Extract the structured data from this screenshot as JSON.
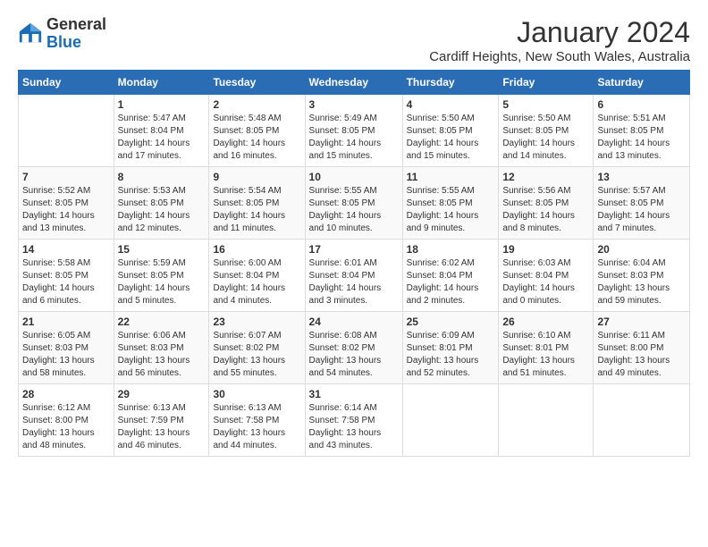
{
  "logo": {
    "line1": "General",
    "line2": "Blue"
  },
  "title": "January 2024",
  "location": "Cardiff Heights, New South Wales, Australia",
  "days_of_week": [
    "Sunday",
    "Monday",
    "Tuesday",
    "Wednesday",
    "Thursday",
    "Friday",
    "Saturday"
  ],
  "weeks": [
    [
      {
        "num": "",
        "info": ""
      },
      {
        "num": "1",
        "info": "Sunrise: 5:47 AM\nSunset: 8:04 PM\nDaylight: 14 hours\nand 17 minutes."
      },
      {
        "num": "2",
        "info": "Sunrise: 5:48 AM\nSunset: 8:05 PM\nDaylight: 14 hours\nand 16 minutes."
      },
      {
        "num": "3",
        "info": "Sunrise: 5:49 AM\nSunset: 8:05 PM\nDaylight: 14 hours\nand 15 minutes."
      },
      {
        "num": "4",
        "info": "Sunrise: 5:50 AM\nSunset: 8:05 PM\nDaylight: 14 hours\nand 15 minutes."
      },
      {
        "num": "5",
        "info": "Sunrise: 5:50 AM\nSunset: 8:05 PM\nDaylight: 14 hours\nand 14 minutes."
      },
      {
        "num": "6",
        "info": "Sunrise: 5:51 AM\nSunset: 8:05 PM\nDaylight: 14 hours\nand 13 minutes."
      }
    ],
    [
      {
        "num": "7",
        "info": "Sunrise: 5:52 AM\nSunset: 8:05 PM\nDaylight: 14 hours\nand 13 minutes."
      },
      {
        "num": "8",
        "info": "Sunrise: 5:53 AM\nSunset: 8:05 PM\nDaylight: 14 hours\nand 12 minutes."
      },
      {
        "num": "9",
        "info": "Sunrise: 5:54 AM\nSunset: 8:05 PM\nDaylight: 14 hours\nand 11 minutes."
      },
      {
        "num": "10",
        "info": "Sunrise: 5:55 AM\nSunset: 8:05 PM\nDaylight: 14 hours\nand 10 minutes."
      },
      {
        "num": "11",
        "info": "Sunrise: 5:55 AM\nSunset: 8:05 PM\nDaylight: 14 hours\nand 9 minutes."
      },
      {
        "num": "12",
        "info": "Sunrise: 5:56 AM\nSunset: 8:05 PM\nDaylight: 14 hours\nand 8 minutes."
      },
      {
        "num": "13",
        "info": "Sunrise: 5:57 AM\nSunset: 8:05 PM\nDaylight: 14 hours\nand 7 minutes."
      }
    ],
    [
      {
        "num": "14",
        "info": "Sunrise: 5:58 AM\nSunset: 8:05 PM\nDaylight: 14 hours\nand 6 minutes."
      },
      {
        "num": "15",
        "info": "Sunrise: 5:59 AM\nSunset: 8:05 PM\nDaylight: 14 hours\nand 5 minutes."
      },
      {
        "num": "16",
        "info": "Sunrise: 6:00 AM\nSunset: 8:04 PM\nDaylight: 14 hours\nand 4 minutes."
      },
      {
        "num": "17",
        "info": "Sunrise: 6:01 AM\nSunset: 8:04 PM\nDaylight: 14 hours\nand 3 minutes."
      },
      {
        "num": "18",
        "info": "Sunrise: 6:02 AM\nSunset: 8:04 PM\nDaylight: 14 hours\nand 2 minutes."
      },
      {
        "num": "19",
        "info": "Sunrise: 6:03 AM\nSunset: 8:04 PM\nDaylight: 14 hours\nand 0 minutes."
      },
      {
        "num": "20",
        "info": "Sunrise: 6:04 AM\nSunset: 8:03 PM\nDaylight: 13 hours\nand 59 minutes."
      }
    ],
    [
      {
        "num": "21",
        "info": "Sunrise: 6:05 AM\nSunset: 8:03 PM\nDaylight: 13 hours\nand 58 minutes."
      },
      {
        "num": "22",
        "info": "Sunrise: 6:06 AM\nSunset: 8:03 PM\nDaylight: 13 hours\nand 56 minutes."
      },
      {
        "num": "23",
        "info": "Sunrise: 6:07 AM\nSunset: 8:02 PM\nDaylight: 13 hours\nand 55 minutes."
      },
      {
        "num": "24",
        "info": "Sunrise: 6:08 AM\nSunset: 8:02 PM\nDaylight: 13 hours\nand 54 minutes."
      },
      {
        "num": "25",
        "info": "Sunrise: 6:09 AM\nSunset: 8:01 PM\nDaylight: 13 hours\nand 52 minutes."
      },
      {
        "num": "26",
        "info": "Sunrise: 6:10 AM\nSunset: 8:01 PM\nDaylight: 13 hours\nand 51 minutes."
      },
      {
        "num": "27",
        "info": "Sunrise: 6:11 AM\nSunset: 8:00 PM\nDaylight: 13 hours\nand 49 minutes."
      }
    ],
    [
      {
        "num": "28",
        "info": "Sunrise: 6:12 AM\nSunset: 8:00 PM\nDaylight: 13 hours\nand 48 minutes."
      },
      {
        "num": "29",
        "info": "Sunrise: 6:13 AM\nSunset: 7:59 PM\nDaylight: 13 hours\nand 46 minutes."
      },
      {
        "num": "30",
        "info": "Sunrise: 6:13 AM\nSunset: 7:58 PM\nDaylight: 13 hours\nand 44 minutes."
      },
      {
        "num": "31",
        "info": "Sunrise: 6:14 AM\nSunset: 7:58 PM\nDaylight: 13 hours\nand 43 minutes."
      },
      {
        "num": "",
        "info": ""
      },
      {
        "num": "",
        "info": ""
      },
      {
        "num": "",
        "info": ""
      }
    ]
  ]
}
